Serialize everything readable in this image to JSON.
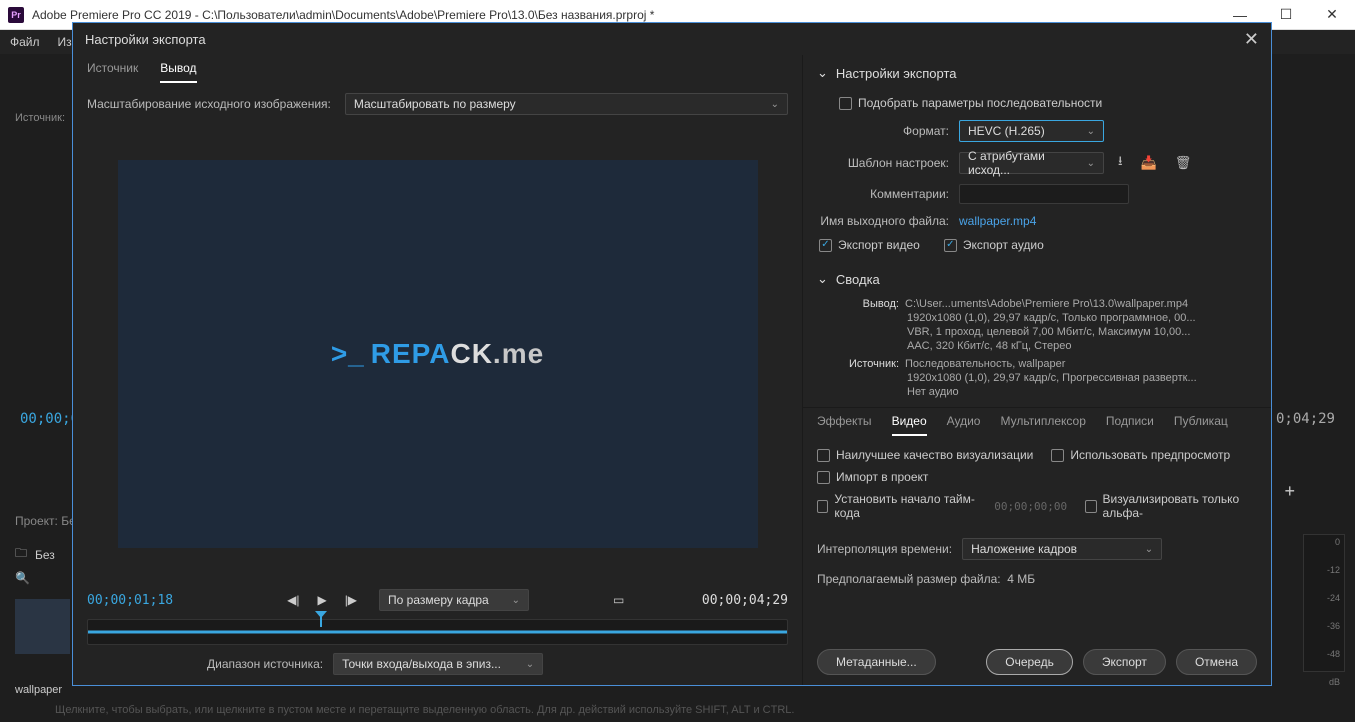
{
  "window": {
    "title": "Adobe Premiere Pro CC 2019 - C:\\Пользователи\\admin\\Documents\\Adobe\\Premiere Pro\\13.0\\Без названия.prproj *",
    "menu_file": "Файл",
    "menu_edit_trunc": "Из"
  },
  "bg": {
    "tc_left": "00;00;0",
    "tc_right": "0;04;29",
    "project_label": "Проект: Бе",
    "bin_label": "Без",
    "thumb_label": "wallpaper",
    "hint": "Щелкните, чтобы выбрать, или щелкните в пустом месте и перетащите выделенную область. Для др. действий используйте SHIFT, ALT и CTRL.",
    "ticks": [
      "0",
      "-12",
      "-24",
      "-36",
      "-48",
      "dB"
    ],
    "src_label_trunc": "Источник:"
  },
  "dlg": {
    "title": "Настройки экспорта",
    "tabs": {
      "source": "Источник",
      "output": "Вывод"
    },
    "scale_label": "Масштабирование исходного изображения:",
    "scale_value": "Масштабировать по размеру",
    "logo_prompt": ">_",
    "logo_re": "REPA",
    "logo_ck": "CK",
    "logo_me": ".me",
    "tc_cur": "00;00;01;18",
    "tc_end": "00;00;04;29",
    "fit_label": "По размеру кадра",
    "range_label": "Диапазон источника:",
    "range_value": "Точки входа/выхода в эпиз...",
    "export_settings": "Настройки экспорта",
    "match_seq": "Подобрать параметры последовательности",
    "format_label": "Формат:",
    "format_value": "HEVC (H.265)",
    "preset_label": "Шаблон настроек:",
    "preset_value": "С атрибутами исход...",
    "comments_label": "Комментарии:",
    "outname_label": "Имя выходного файла:",
    "outname_value": "wallpaper.mp4",
    "export_video": "Экспорт видео",
    "export_audio": "Экспорт аудио",
    "summary_header": "Сводка",
    "summary_out_label": "Вывод:",
    "summary_out_l1": "C:\\User...uments\\Adobe\\Premiere Pro\\13.0\\wallpaper.mp4",
    "summary_out_l2": "1920x1080 (1,0), 29,97 кадр/с, Только программное, 00...",
    "summary_out_l3": "VBR, 1 проход, целевой 7,00 Мбит/с, Максимум 10,00...",
    "summary_out_l4": "AAC, 320 Кбит/с, 48 кГц, Стерео",
    "summary_src_label": "Источник:",
    "summary_src_l1": "Последовательность, wallpaper",
    "summary_src_l2": "1920x1080 (1,0), 29,97 кадр/с, Прогрессивная развертк...",
    "summary_src_l3": "Нет аудио",
    "subtabs": {
      "fx": "Эффекты",
      "video": "Видео",
      "audio": "Аудио",
      "mux": "Мультиплексор",
      "cc": "Подписи",
      "pub": "Публикац"
    },
    "opt_maxq": "Наилучшее качество визуализации",
    "opt_preview": "Использовать предпросмотр",
    "opt_import": "Импорт в проект",
    "opt_set_tc": "Установить начало тайм-кода",
    "opt_tc_val": "00;00;00;00",
    "opt_alpha": "Визуализировать только альфа-",
    "interp_label": "Интерполяция времени:",
    "interp_value": "Наложение кадров",
    "est_label": "Предполагаемый размер файла:",
    "est_value": "4 МБ",
    "btn_meta": "Метаданные...",
    "btn_queue": "Очередь",
    "btn_export": "Экспорт",
    "btn_cancel": "Отмена"
  }
}
